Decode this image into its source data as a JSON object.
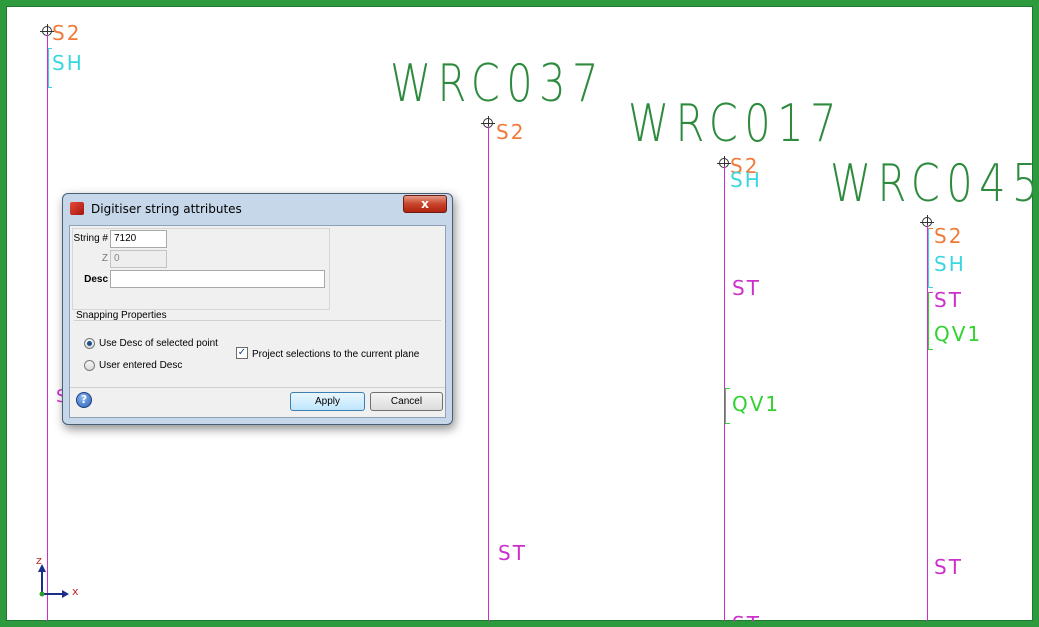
{
  "viewport": {
    "holes": [
      {
        "name": "WRC037",
        "color": "#2e8b3e"
      },
      {
        "name": "WRC017",
        "color": "#2e8b3e"
      },
      {
        "name": "WRC045",
        "color": "#2e8b3e"
      }
    ],
    "tags": {
      "s2": "S2",
      "sh": "SH",
      "st": "ST",
      "qv1": "QV1",
      "partial_s": "S"
    },
    "axis": {
      "z": "z",
      "x": "x"
    }
  },
  "dialog": {
    "title": "Digitiser string attributes",
    "close_label": "x",
    "string_label": "String #",
    "string_value": "7120",
    "z_label": "Z",
    "z_value": "0",
    "desc_label": "Desc",
    "desc_value": "",
    "snapping_title": "Snapping Properties",
    "radio_use_desc": "Use Desc of selected point",
    "radio_user_desc": "User entered Desc",
    "radio_selected": "use_desc",
    "checkbox_project": "Project selections to the current plane",
    "checkbox_checked": true,
    "help_label": "?",
    "apply_label": "Apply",
    "cancel_label": "Cancel"
  },
  "colors": {
    "frame": "#2e9a3e",
    "trace": "#d02bd0",
    "s2": "#f07a3a",
    "sh": "#3ad6e0",
    "st": "#cc2fcc",
    "qv": "#32d232"
  }
}
